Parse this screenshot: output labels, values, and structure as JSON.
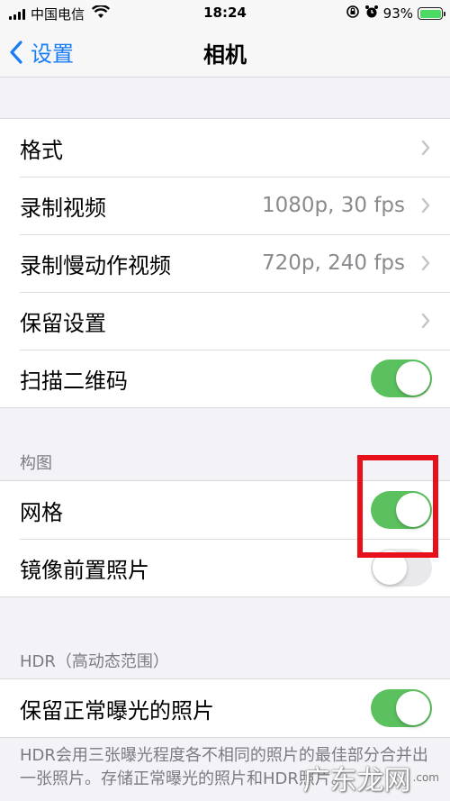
{
  "status_bar": {
    "carrier": "中国电信",
    "time": "18:24",
    "battery_percent": "93%"
  },
  "nav": {
    "back_label": "设置",
    "title": "相机"
  },
  "group1": {
    "format_label": "格式",
    "record_video_label": "录制视频",
    "record_video_value": "1080p, 30 fps",
    "record_slomo_label": "录制慢动作视频",
    "record_slomo_value": "720p, 240 fps",
    "preserve_settings_label": "保留设置",
    "scan_qr_label": "扫描二维码"
  },
  "composition": {
    "header": "构图",
    "grid_label": "网格",
    "mirror_front_label": "镜像前置照片"
  },
  "hdr": {
    "header": "HDR（高动态范围）",
    "keep_normal_label": "保留正常曝光的照片",
    "note": "HDR会用三张曝光程度各不相同的照片的最佳部分合并出一张照片。存储正常曝光的照片和HDR照片。"
  },
  "watermark": {
    "text": "广东龙网",
    "sub": ".com"
  },
  "toggles": {
    "scan_qr": true,
    "grid": true,
    "mirror_front": false,
    "keep_normal": true
  },
  "colors": {
    "accent": "#1a7cf5",
    "toggle_on": "#5bc15e",
    "toggle_off": "#e9e9eb",
    "highlight": "#e8101a"
  }
}
